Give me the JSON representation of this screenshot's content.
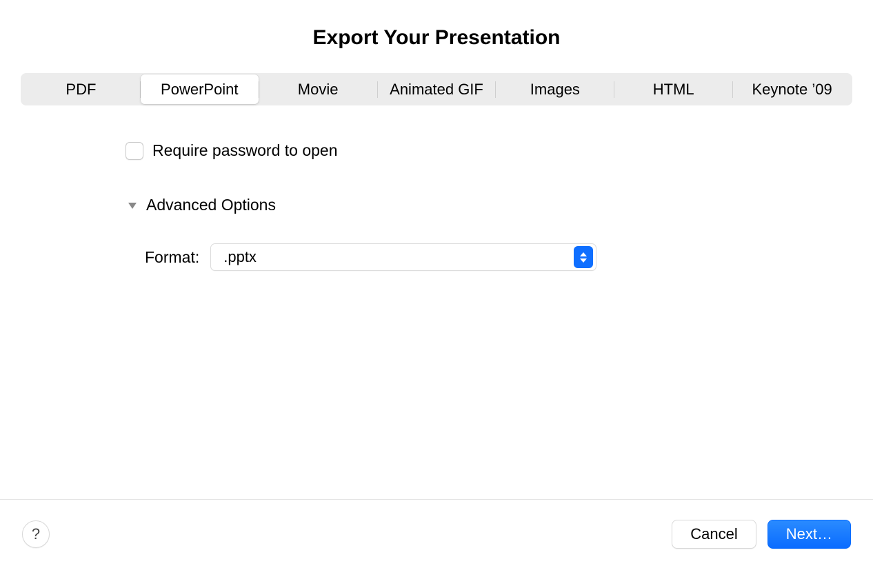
{
  "dialog": {
    "title": "Export Your Presentation"
  },
  "tabs": [
    {
      "id": "pdf",
      "label": "PDF",
      "active": false
    },
    {
      "id": "powerpoint",
      "label": "PowerPoint",
      "active": true
    },
    {
      "id": "movie",
      "label": "Movie",
      "active": false
    },
    {
      "id": "animated-gif",
      "label": "Animated GIF",
      "active": false
    },
    {
      "id": "images",
      "label": "Images",
      "active": false
    },
    {
      "id": "html",
      "label": "HTML",
      "active": false
    },
    {
      "id": "keynote-09",
      "label": "Keynote ’09",
      "active": false
    }
  ],
  "options": {
    "require_password_label": "Require password to open",
    "require_password_checked": false,
    "advanced_label": "Advanced Options",
    "advanced_expanded": true,
    "format_label": "Format:",
    "format_value": ".pptx"
  },
  "footer": {
    "help_label": "?",
    "cancel_label": "Cancel",
    "next_label": "Next…"
  }
}
